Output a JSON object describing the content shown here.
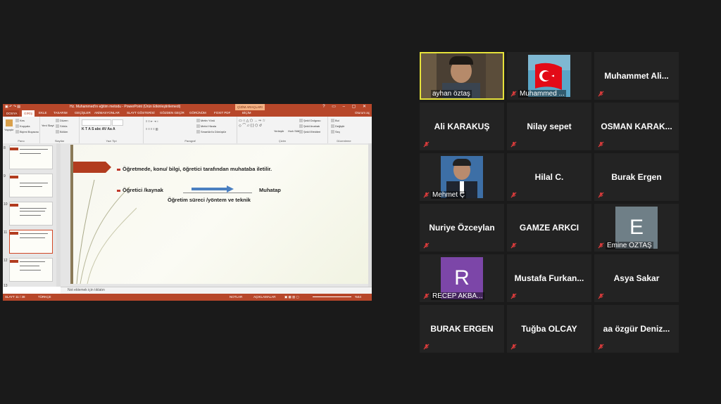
{
  "powerpoint": {
    "window_title": "Hz. Muhammed'in eğitim metodu - PowerPoint (Ürün Etkinleştirilemedi)",
    "context_tab": "ÇİZİM ARAÇLARI",
    "tabs": [
      "DOSYA",
      "GİRİŞ",
      "EKLE",
      "TASARIM",
      "GEÇİŞLER",
      "ANİMASYONLAR",
      "SLAYT GÖSTERİSİ",
      "GÖZDEN GEÇİR",
      "GÖRÜNÜM",
      "FOXIT PDF",
      "BİÇİM"
    ],
    "user_label": "Oturum aç",
    "ribbon": {
      "paste_label": "Yapıştır",
      "cut": "Kes",
      "copy": "Kopyala",
      "format_painter": "Biçimi Boyacısı",
      "new_slide": "Yeni Slayt",
      "layout": "Düzen",
      "reset": "Sıfırla",
      "section": "Bölüm",
      "text_direction": "Metin Yönü",
      "align_text": "Metni Hizala",
      "smartart": "SmartArt'a Dönüştür",
      "arrange": "Yerleştir",
      "quick_styles": "Hızlı Stiller",
      "shape_fill": "Şekil Dolgusu",
      "shape_outline": "Şekil Anahatı",
      "shape_effects": "Şekil Efektleri",
      "find": "Bul",
      "replace": "Değiştir",
      "select": "Seç",
      "groups": [
        "Pano",
        "Slaytlar",
        "Yazı Tipi",
        "Paragraf",
        "Çizim",
        "Düzenleme"
      ]
    },
    "slide_numbers": [
      "8",
      "9",
      "10",
      "11",
      "12",
      "13"
    ],
    "selected_slide": "11",
    "slide": {
      "line1": "Öğretmede, konu/ bilgi, öğretici tarafından muhataba iletilir.",
      "line2_left": "Öğretici /kaynak",
      "line2_right": "Muhatap",
      "line3": "Öğretim süreci /yöntem ve teknik"
    },
    "notes_placeholder": "Not eklemek için tıklatın",
    "status": {
      "slide_count": "SLAYT 11 / 38",
      "language": "TÜRKÇE",
      "notes": "NOTLAR",
      "comments": "AÇIKLAMALAR",
      "zoom": "%64"
    }
  },
  "participants": [
    {
      "name": "ayhan öztaş",
      "type": "video",
      "active": true
    },
    {
      "name": "Muhammed ...",
      "type": "flag"
    },
    {
      "name": "Muhammet  Ali...",
      "type": "name"
    },
    {
      "name": "Ali KARAKUŞ",
      "type": "name"
    },
    {
      "name": "Nilay sepet",
      "type": "name"
    },
    {
      "name": "OSMAN  KARAK...",
      "type": "name"
    },
    {
      "name": "Mehmet Ç",
      "type": "photo"
    },
    {
      "name": "Hilal C.",
      "type": "name"
    },
    {
      "name": "Burak Ergen",
      "type": "name"
    },
    {
      "name": "Nuriye Özceylan",
      "type": "name"
    },
    {
      "name": "GAMZE ARKCI",
      "type": "name"
    },
    {
      "name": "Emine ÖZTAŞ",
      "type": "letter",
      "letter": "E",
      "color": "#6f7f87"
    },
    {
      "name": "RECEP AKBA...",
      "type": "letter",
      "letter": "R",
      "color": "#7c46a8"
    },
    {
      "name": "Mustafa  Furkan...",
      "type": "name"
    },
    {
      "name": "Asya Sakar",
      "type": "name"
    },
    {
      "name": "BURAK ERGEN",
      "type": "name"
    },
    {
      "name": "Tuğba OLCAY",
      "type": "name"
    },
    {
      "name": "aa  özgür  Deniz...",
      "type": "name"
    }
  ],
  "colors": {
    "active_speaker": "#e6e23a",
    "muted_icon": "#e03c3c",
    "ppt_accent": "#b7472a"
  }
}
